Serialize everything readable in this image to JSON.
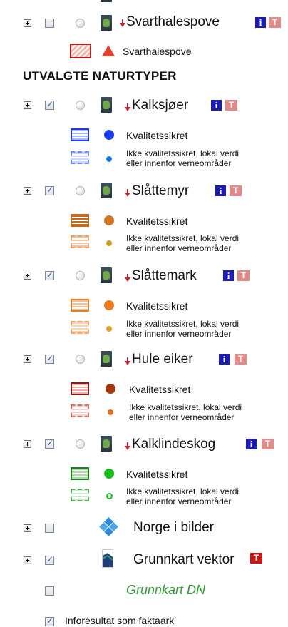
{
  "layers": [
    {
      "name": "Svarthalespove"
    },
    {
      "name": "Kalksjøer"
    },
    {
      "name": "Slåttemyr"
    },
    {
      "name": "Slåttemark"
    },
    {
      "name": "Hule eiker"
    },
    {
      "name": "Kalklindeskog"
    }
  ],
  "svarthalespove_legend": "Svarthalespove",
  "section_heading": "UTVALGTE NATURTYPER",
  "legend": {
    "quality": "Kvalitetssikret",
    "not_quality_line1": "Ikke kvalitetssikret, lokal verdi",
    "not_quality_line2": "eller innenfor verneområder"
  },
  "norge_i_bilder": "Norge i bilder",
  "grunnkart_vektor": "Grunnkart vektor",
  "grunnkart_dn": "Grunnkart DN",
  "inforesultat": "Inforesultat som faktaark",
  "icons": {
    "info": "i",
    "table": "T"
  },
  "colors": {
    "kalksjoer": "#1a3cf0",
    "slattemyr": "#c46a1b",
    "slattemark": "#f07a1a",
    "hule_eiker": "#9a2a14",
    "kalklindeskog": "#17a317",
    "svarthalespove": "#e0412a",
    "grunnkart_dn": "#2c9a2c"
  }
}
